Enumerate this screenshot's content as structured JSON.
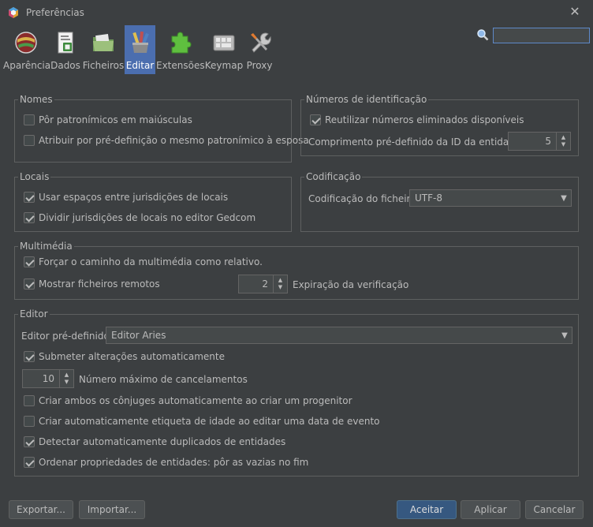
{
  "window": {
    "title": "Preferências",
    "icon": "app-hex-icon",
    "close_glyph": "✕"
  },
  "toolbar": [
    {
      "label": "Aparência",
      "icon": "appearance-globe-icon",
      "active": false
    },
    {
      "label": "Dados",
      "icon": "data-document-icon",
      "active": false
    },
    {
      "label": "Ficheiros",
      "icon": "folder-icon",
      "active": false
    },
    {
      "label": "Editar",
      "icon": "edit-pencils-icon",
      "active": true
    },
    {
      "label": "Extensões",
      "icon": "puzzle-icon",
      "active": false
    },
    {
      "label": "Keymap",
      "icon": "keyboard-icon",
      "active": false
    },
    {
      "label": "Proxy",
      "icon": "wrench-icon",
      "active": false
    }
  ],
  "search": {
    "value": "",
    "placeholder": ""
  },
  "nomes": {
    "title": "Nomes",
    "items": [
      {
        "label": "Pôr patronímicos em maiúsculas",
        "checked": false
      },
      {
        "label": "Atribuir por pré-definição o mesmo patronímico à esposa",
        "checked": false
      }
    ]
  },
  "numeros": {
    "title": "Números de identificação",
    "reuse_label": "Reutilizar números eliminados disponíveis",
    "reuse_checked": true,
    "length_label": "Comprimento pré-definido da ID da entidade:",
    "length_value": "5"
  },
  "locais": {
    "title": "Locais",
    "items": [
      {
        "label": "Usar espaços entre jurisdições de locais",
        "checked": true
      },
      {
        "label": "Dividir jurisdições de locais no editor Gedcom",
        "checked": true
      }
    ]
  },
  "codificacao": {
    "title": "Codificação",
    "label": "Codificação do ficheiro",
    "value": "UTF-8"
  },
  "multimedia": {
    "title": "Multimédia",
    "force_label": "Forçar o caminho da multimédia como relativo.",
    "force_checked": true,
    "remote_label": "Mostrar ficheiros remotos",
    "remote_checked": true,
    "timeout_value": "2",
    "timeout_label": "Expiração da verificação"
  },
  "editor": {
    "title": "Editor",
    "default_label": "Editor pré-definido",
    "default_value": "Editor Aries",
    "auto_commit_label": "Submeter alterações automaticamente",
    "auto_commit_checked": true,
    "undo_value": "10",
    "undo_label": "Número máximo de cancelamentos",
    "items": [
      {
        "label": "Criar ambos os cônjuges automaticamente ao criar um progenitor",
        "checked": false
      },
      {
        "label": "Criar automaticamente etiqueta de idade ao editar uma data de evento",
        "checked": false
      },
      {
        "label": "Detectar automaticamente duplicados de entidades",
        "checked": true
      },
      {
        "label": "Ordenar propriedades de entidades: pôr as vazias no fim",
        "checked": true
      }
    ]
  },
  "buttons": {
    "export": "Exportar...",
    "import": "Importar...",
    "accept": "Aceitar",
    "apply": "Aplicar",
    "cancel": "Cancelar"
  },
  "colors": {
    "background": "#3c3f41",
    "accent": "#4b6eaf",
    "text": "#bbbbbb",
    "primary_button": "#365880"
  }
}
